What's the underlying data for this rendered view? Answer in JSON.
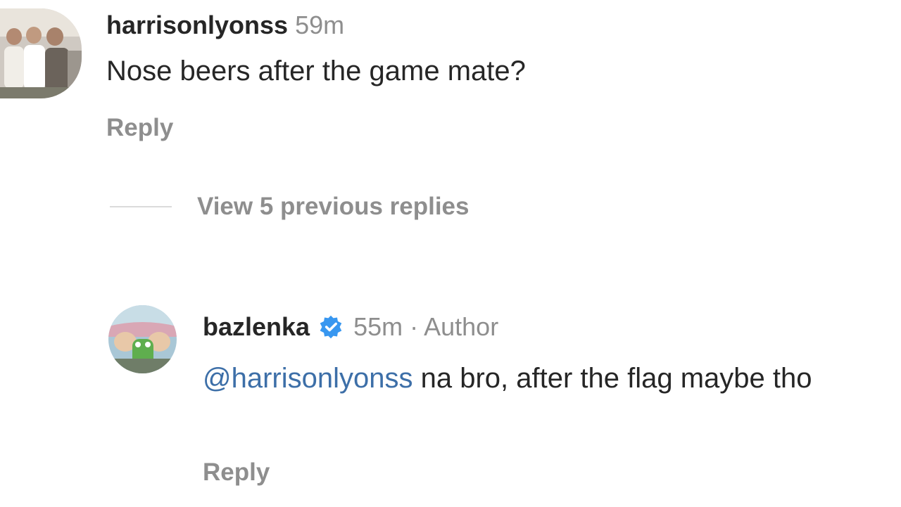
{
  "comments": [
    {
      "username": "harrisonlyonss",
      "time": "59m",
      "text": "Nose beers after the game mate?",
      "reply_label": "Reply",
      "avatar_icon": "group-photo-avatar"
    },
    {
      "username": "bazlenka",
      "verified_icon": "verified-badge-icon",
      "time_author": "55m · Author",
      "mention": "@harrisonlyonss",
      "text": " na bro, after the flag maybe tho",
      "reply_label": "Reply",
      "avatar_icon": "cartoon-avatar"
    }
  ],
  "thread": {
    "view_replies_label": "View 5 previous replies"
  },
  "colors": {
    "text": "#262626",
    "muted": "#8e8e8e",
    "mention": "#3d6fa8",
    "verified": "#3897f0"
  }
}
